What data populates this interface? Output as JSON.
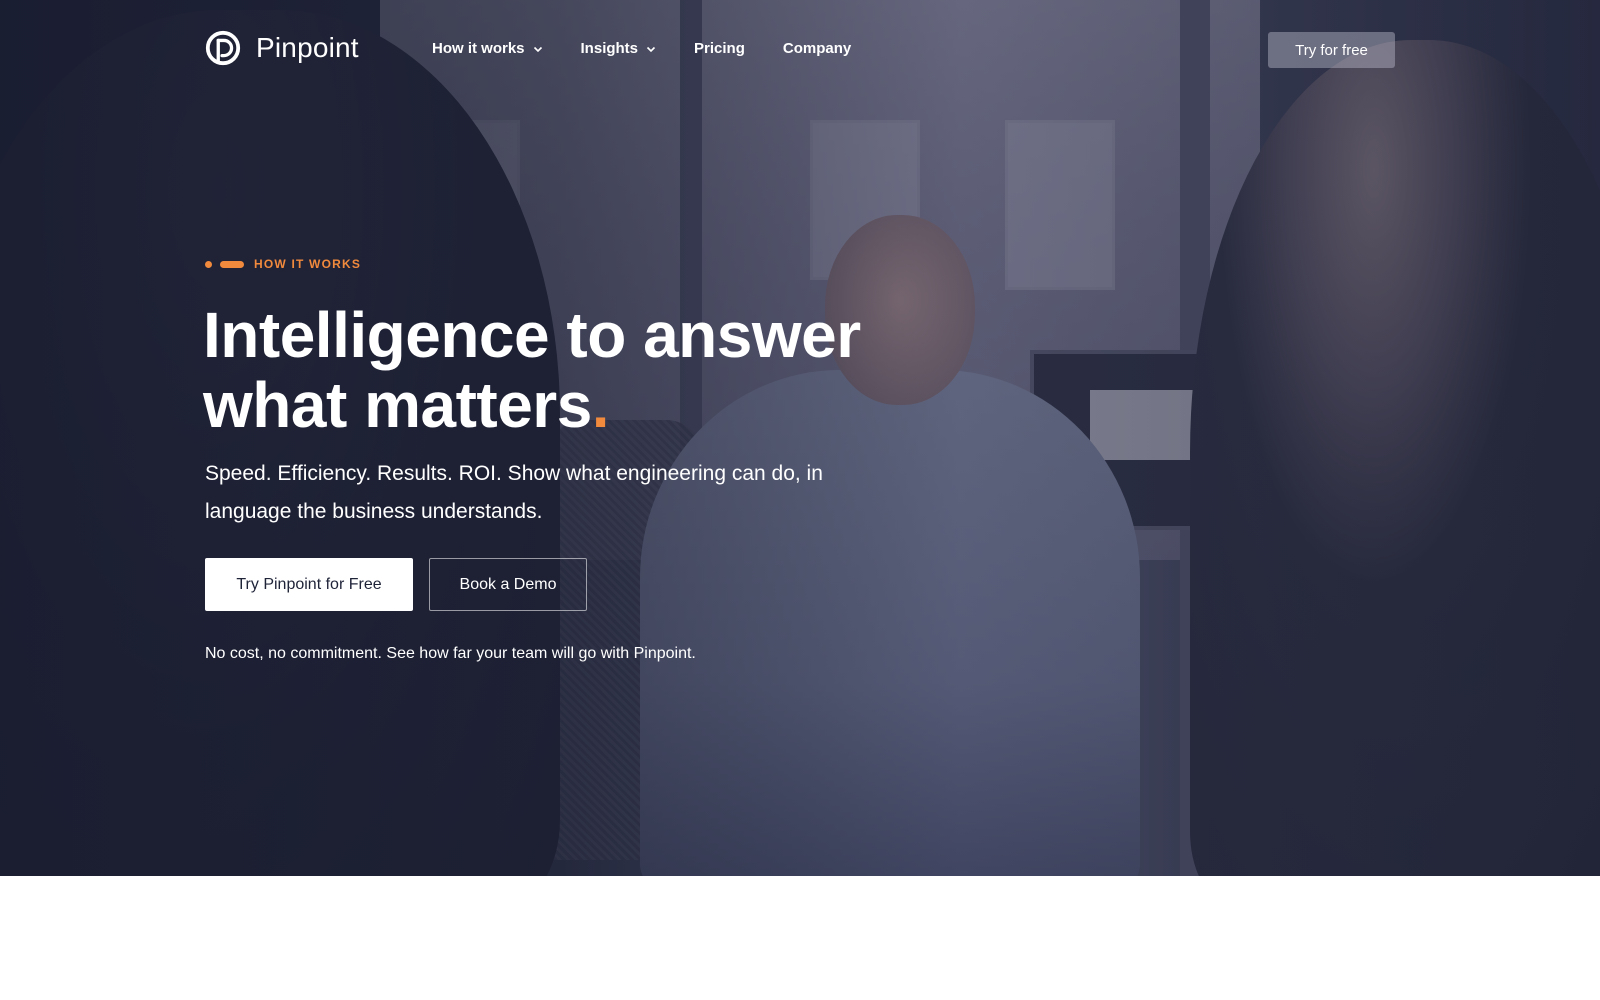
{
  "brand": {
    "name": "Pinpoint"
  },
  "nav": {
    "items": [
      {
        "label": "How it works",
        "has_dropdown": true
      },
      {
        "label": "Insights",
        "has_dropdown": true
      },
      {
        "label": "Pricing",
        "has_dropdown": false
      },
      {
        "label": "Company",
        "has_dropdown": false
      }
    ],
    "cta_label": "Try for free"
  },
  "hero": {
    "eyebrow": "HOW IT WORKS",
    "headline_line1": "Intelligence to answer",
    "headline_line2": "what matters",
    "headline_accent": ".",
    "subheadline": "Speed. Efficiency. Results. ROI. Show what engineering can do, in language the business understands.",
    "primary_button": "Try Pinpoint for Free",
    "secondary_button": "Book a Demo",
    "note": "No cost, no commitment. See how far your team will go with Pinpoint."
  },
  "colors": {
    "accent": "#f18a3d",
    "hero_dark": "#1f2338",
    "text_light": "#ffffff",
    "page_background": "#ffffff"
  }
}
